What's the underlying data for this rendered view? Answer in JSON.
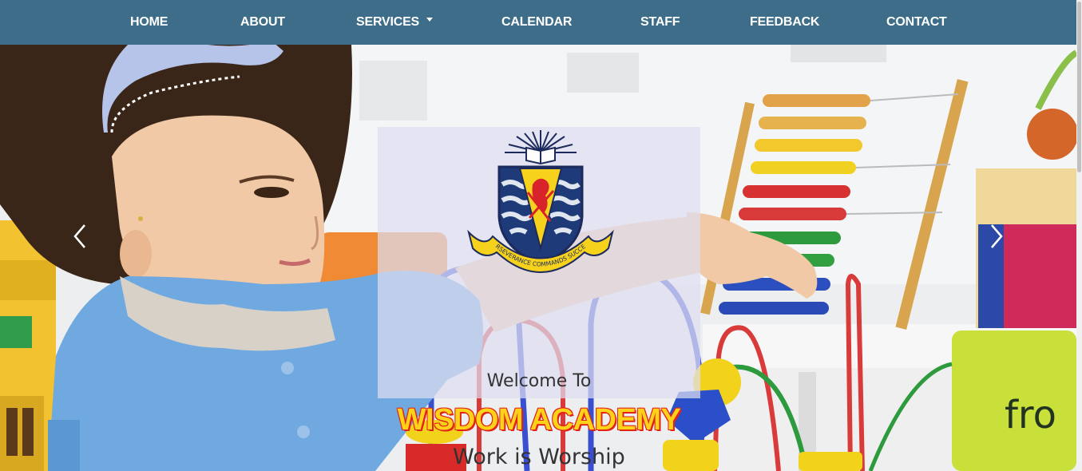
{
  "nav": {
    "items": [
      {
        "label": "HOME"
      },
      {
        "label": "ABOUT"
      },
      {
        "label": "SERVICES",
        "has_dropdown": true
      },
      {
        "label": "CALENDAR"
      },
      {
        "label": "STAFF"
      },
      {
        "label": "FEEDBACK"
      },
      {
        "label": "CONTACT"
      }
    ]
  },
  "hero": {
    "welcome": "Welcome To",
    "title": "WISDOM ACADEMY",
    "motto": "Work is Worship",
    "crest_motto": "PERSEVERANCE COMMANDS SUCCESS",
    "prev_icon": "chevron-left-icon",
    "next_icon": "chevron-right-icon"
  },
  "colors": {
    "navbar": "#3d6d88",
    "nav_text": "#ffffff",
    "title_fill": "#ffd21a",
    "title_outline": "#e2231a",
    "caption_bg": "rgba(222,222,240,0.72)"
  }
}
